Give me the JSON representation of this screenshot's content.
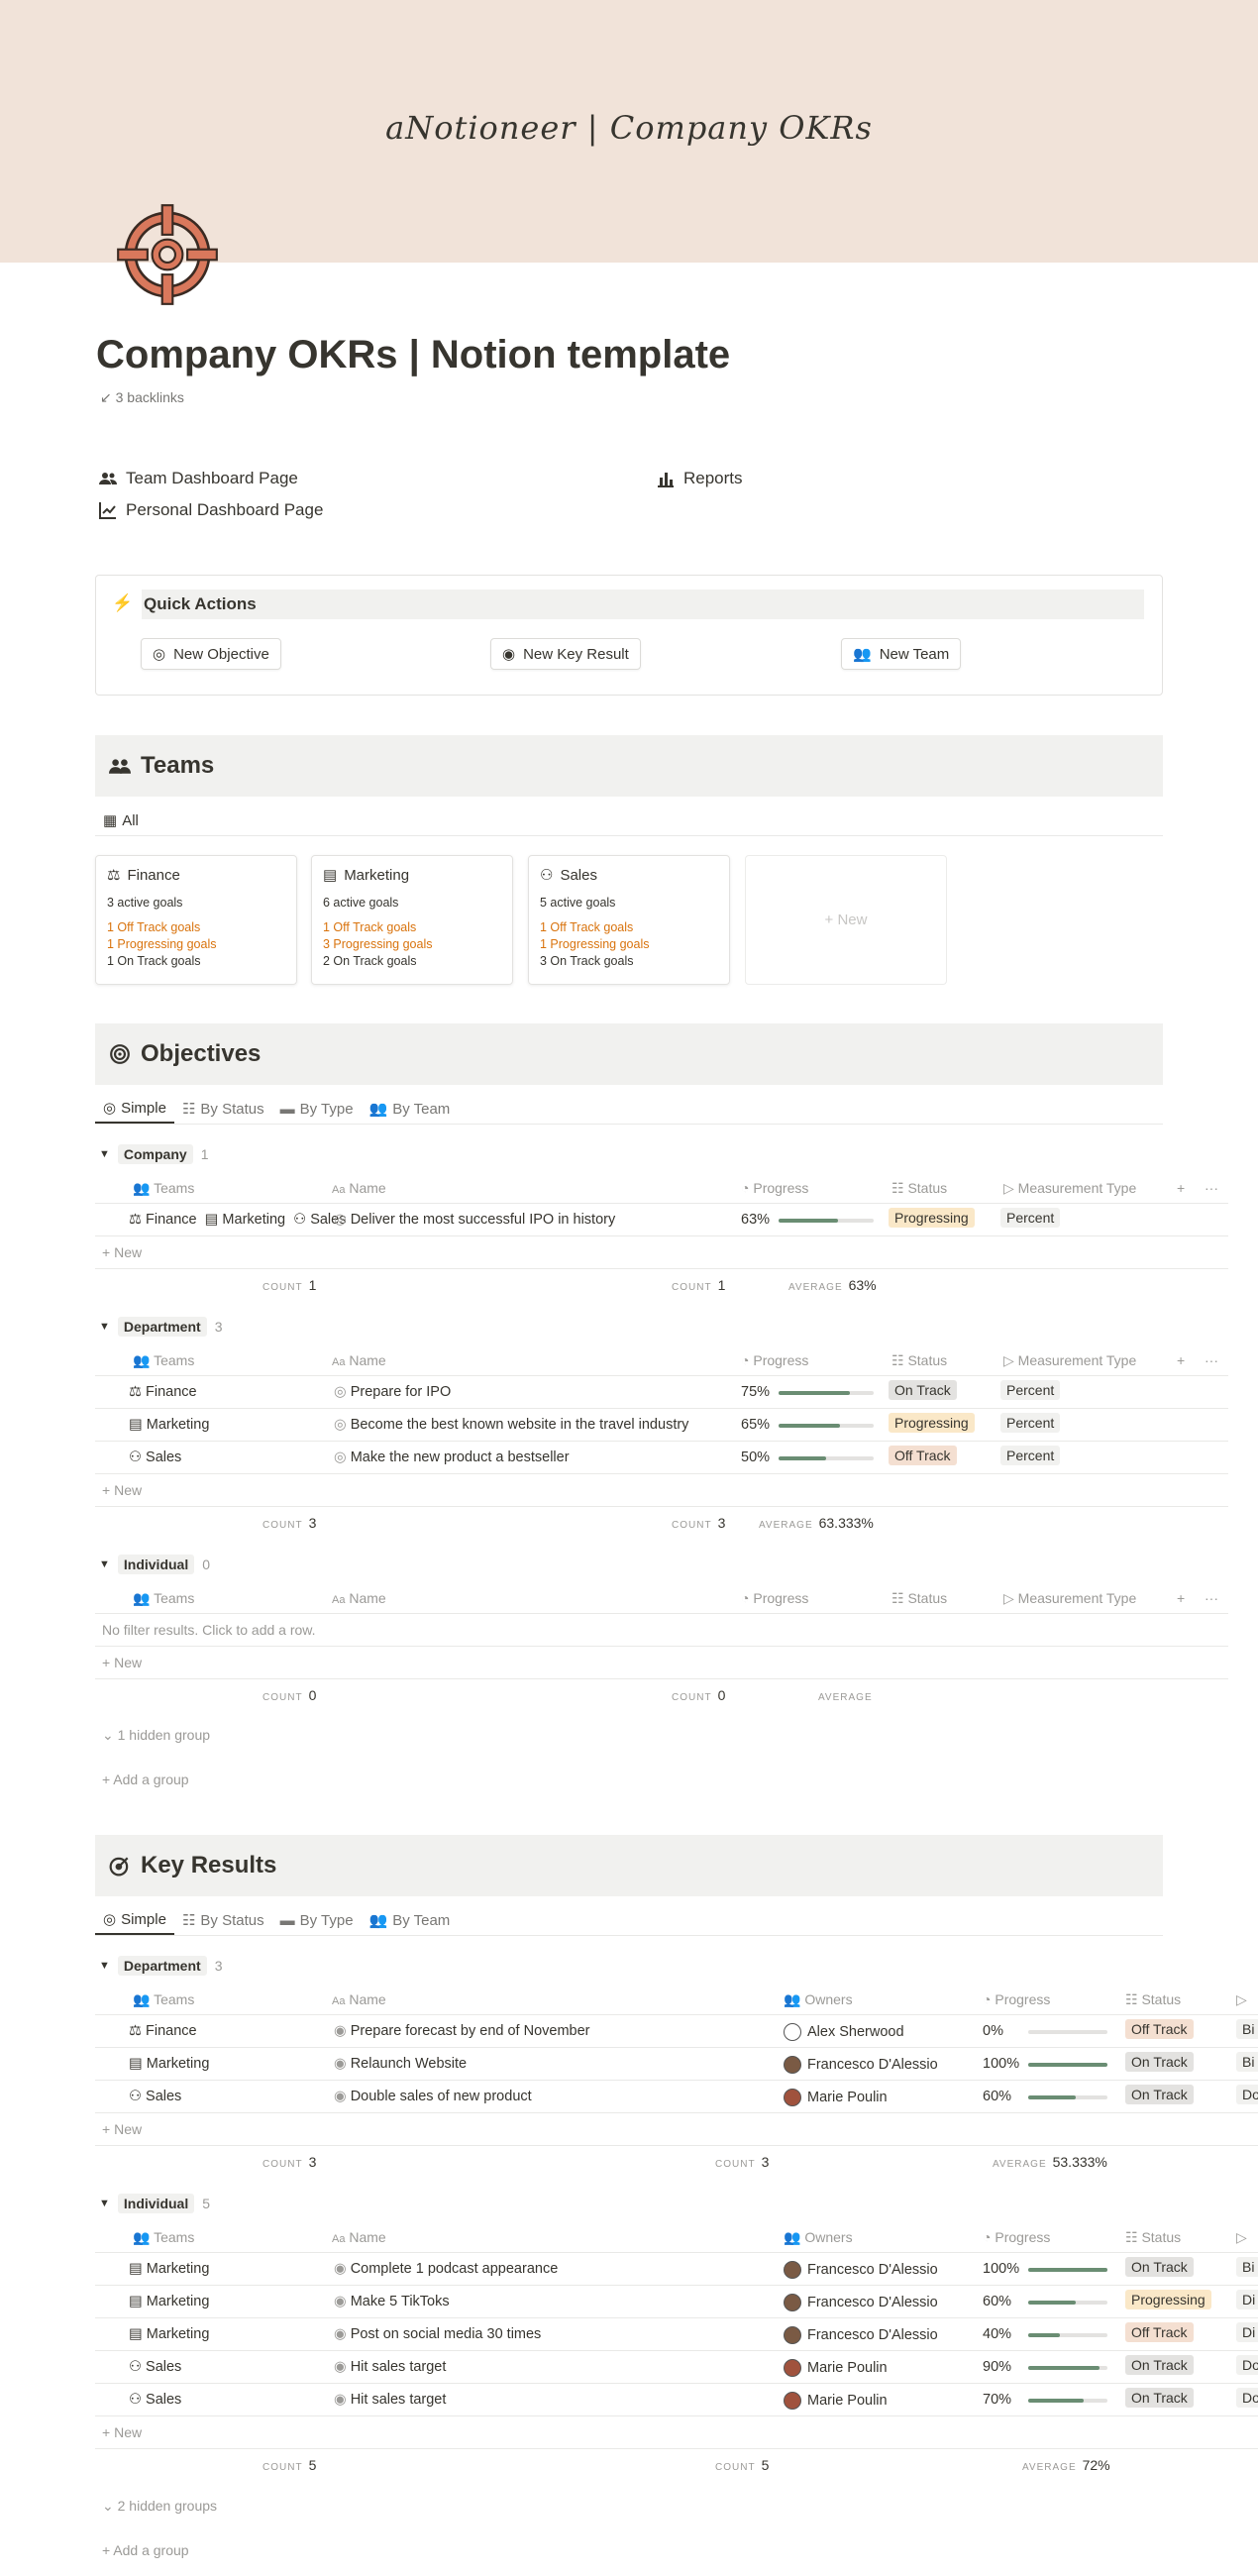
{
  "cover": {
    "title": "aNotioneer | Company OKRs"
  },
  "page": {
    "title": "Company OKRs | Notion template",
    "backlinks": "3 backlinks"
  },
  "links": {
    "team_dashboard": "Team Dashboard Page",
    "personal_dashboard": "Personal Dashboard Page",
    "reports": "Reports"
  },
  "quick_actions": {
    "title": "Quick Actions",
    "new_objective": "New Objective",
    "new_key_result": "New Key Result",
    "new_team": "New Team"
  },
  "teams": {
    "title": "Teams",
    "view": "All",
    "new_label": "New",
    "cards": [
      {
        "name": "Finance",
        "active": "3 active goals",
        "off": "1 Off Track goals",
        "prog": "1 Progressing goals",
        "on": "1 On Track goals"
      },
      {
        "name": "Marketing",
        "active": "6 active goals",
        "off": "1 Off Track goals",
        "prog": "3 Progressing goals",
        "on": "2 On Track goals"
      },
      {
        "name": "Sales",
        "active": "5 active goals",
        "off": "1 Off Track goals",
        "prog": "1 Progressing goals",
        "on": "3 On Track goals"
      }
    ]
  },
  "tabs": [
    "Simple",
    "By Status",
    "By Type",
    "By Team"
  ],
  "objectives": {
    "title": "Objectives",
    "columns": {
      "teams": "Teams",
      "name": "Name",
      "progress": "Progress",
      "status": "Status",
      "measurement": "Measurement Type"
    },
    "company": {
      "label": "Company",
      "count": "1",
      "rows": [
        {
          "teams": [
            "Finance",
            "Marketing",
            "Sales"
          ],
          "name": "Deliver the most successful IPO in history",
          "progress_text": "63%",
          "progress": 0.63,
          "status": "Progressing",
          "measurement": "Percent"
        }
      ],
      "calc": {
        "count1": "1",
        "count2": "1",
        "average": "63%"
      }
    },
    "department": {
      "label": "Department",
      "count": "3",
      "rows": [
        {
          "team": "Finance",
          "name": "Prepare for IPO",
          "progress_text": "75%",
          "progress": 0.75,
          "status": "On Track",
          "measurement": "Percent"
        },
        {
          "team": "Marketing",
          "name": "Become the best known website in the travel industry",
          "progress_text": "65%",
          "progress": 0.65,
          "status": "Progressing",
          "measurement": "Percent"
        },
        {
          "team": "Sales",
          "name": "Make the new product a bestseller",
          "progress_text": "50%",
          "progress": 0.5,
          "status": "Off Track",
          "measurement": "Percent"
        }
      ],
      "calc": {
        "count1": "3",
        "count2": "3",
        "average": "63.333%"
      }
    },
    "individual": {
      "label": "Individual",
      "count": "0",
      "empty": "No filter results. Click to add a row.",
      "calc": {
        "count1": "0",
        "count2": "0",
        "average": ""
      }
    },
    "hidden": "1 hidden group",
    "add_group": "Add a group"
  },
  "key_results": {
    "title": "Key Results",
    "columns": {
      "teams": "Teams",
      "name": "Name",
      "owners": "Owners",
      "progress": "Progress",
      "status": "Status"
    },
    "department": {
      "label": "Department",
      "count": "3",
      "rows": [
        {
          "team": "Finance",
          "name": "Prepare forecast by end of November",
          "owner": "Alex Sherwood",
          "progress_text": "0%",
          "progress": 0,
          "status": "Off Track",
          "extra": "Bi"
        },
        {
          "team": "Marketing",
          "name": "Relaunch Website",
          "owner": "Francesco D'Alessio",
          "progress_text": "100%",
          "progress": 1,
          "status": "On Track",
          "extra": "Bi"
        },
        {
          "team": "Sales",
          "name": "Double sales of new product",
          "owner": "Marie Poulin",
          "progress_text": "60%",
          "progress": 0.6,
          "status": "On Track",
          "extra": "Do"
        }
      ],
      "calc": {
        "count1": "3",
        "count2": "3",
        "average": "53.333%"
      }
    },
    "individual": {
      "label": "Individual",
      "count": "5",
      "rows": [
        {
          "team": "Marketing",
          "name": "Complete 1 podcast appearance",
          "owner": "Francesco D'Alessio",
          "progress_text": "100%",
          "progress": 1,
          "status": "On Track",
          "extra": "Bi"
        },
        {
          "team": "Marketing",
          "name": "Make 5 TikToks",
          "owner": "Francesco D'Alessio",
          "progress_text": "60%",
          "progress": 0.6,
          "status": "Progressing",
          "extra": "Di"
        },
        {
          "team": "Marketing",
          "name": "Post on social media 30 times",
          "owner": "Francesco D'Alessio",
          "progress_text": "40%",
          "progress": 0.4,
          "status": "Off Track",
          "extra": "Di"
        },
        {
          "team": "Sales",
          "name": "Hit sales target",
          "owner": "Marie Poulin",
          "progress_text": "90%",
          "progress": 0.9,
          "status": "On Track",
          "extra": "Do"
        },
        {
          "team": "Sales",
          "name": "Hit sales target",
          "owner": "Marie Poulin",
          "progress_text": "70%",
          "progress": 0.7,
          "status": "On Track",
          "extra": "Do"
        }
      ],
      "calc": {
        "count1": "5",
        "count2": "5",
        "average": "72%"
      }
    },
    "hidden": "2 hidden groups",
    "add_group": "Add a group"
  },
  "labels": {
    "new": "New",
    "count": "COUNT",
    "average": "AVERAGE",
    "aa": "Aa"
  }
}
